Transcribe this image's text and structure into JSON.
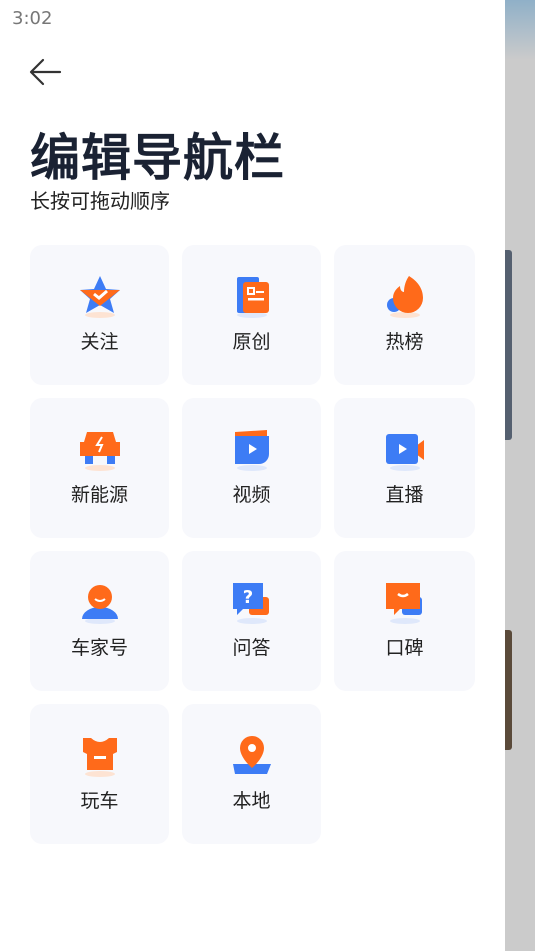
{
  "status": {
    "time": "3:02"
  },
  "header": {
    "title": "编辑导航栏",
    "subtitle": "长按可拖动顺序"
  },
  "colors": {
    "orange": "#ff6a1a",
    "blue": "#3d7cf5",
    "card_bg": "#f7f8fc"
  },
  "items": [
    {
      "label": "关注",
      "icon": "star-check-icon"
    },
    {
      "label": "原创",
      "icon": "document-icon"
    },
    {
      "label": "热榜",
      "icon": "flame-icon"
    },
    {
      "label": "新能源",
      "icon": "ev-car-icon"
    },
    {
      "label": "视频",
      "icon": "video-play-icon"
    },
    {
      "label": "直播",
      "icon": "video-camera-icon"
    },
    {
      "label": "车家号",
      "icon": "user-icon"
    },
    {
      "label": "问答",
      "icon": "question-chat-icon"
    },
    {
      "label": "口碑",
      "icon": "smile-chat-icon"
    },
    {
      "label": "玩车",
      "icon": "shirt-icon"
    },
    {
      "label": "本地",
      "icon": "location-pin-icon"
    }
  ]
}
